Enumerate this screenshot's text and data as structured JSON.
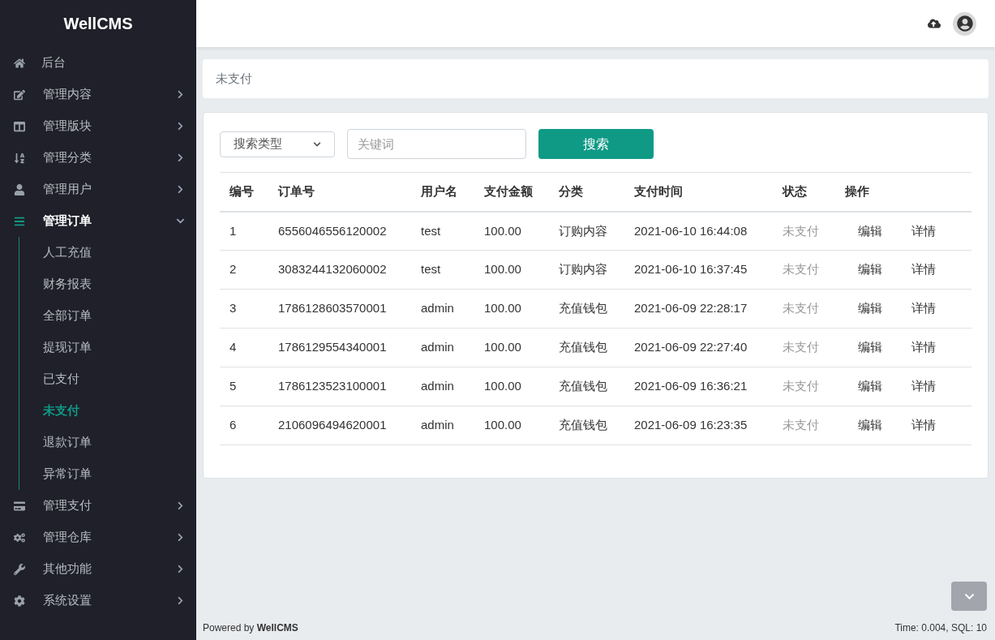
{
  "sidebar": {
    "brand": "WellCMS",
    "items": [
      {
        "label": "后台",
        "kind": "link"
      },
      {
        "label": "管理内容",
        "kind": "group",
        "expanded": false
      },
      {
        "label": "管理版块",
        "kind": "group",
        "expanded": false
      },
      {
        "label": "管理分类",
        "kind": "group",
        "expanded": false
      },
      {
        "label": "管理用户",
        "kind": "group",
        "expanded": false
      },
      {
        "label": "管理订单",
        "kind": "group",
        "expanded": true,
        "children": [
          {
            "label": "人工充值",
            "selected": false
          },
          {
            "label": "财务报表",
            "selected": false
          },
          {
            "label": "全部订单",
            "selected": false
          },
          {
            "label": "提现订单",
            "selected": false
          },
          {
            "label": "已支付",
            "selected": false
          },
          {
            "label": "未支付",
            "selected": true
          },
          {
            "label": "退款订单",
            "selected": false
          },
          {
            "label": "异常订单",
            "selected": false
          }
        ]
      },
      {
        "label": "管理支付",
        "kind": "group",
        "expanded": false
      },
      {
        "label": "管理仓库",
        "kind": "group",
        "expanded": false
      },
      {
        "label": "其他功能",
        "kind": "group",
        "expanded": false
      },
      {
        "label": "系统设置",
        "kind": "group",
        "expanded": false
      }
    ]
  },
  "breadcrumb": "未支付",
  "search": {
    "type_select": "搜索类型",
    "placeholder": "关键词",
    "button": "搜索"
  },
  "table": {
    "columns": [
      "编号",
      "订单号",
      "用户名",
      "支付金额",
      "分类",
      "支付时间",
      "状态",
      "操作"
    ],
    "rows": [
      {
        "id": "1",
        "order_no": "6556046556120002",
        "user": "test",
        "amount": "100.00",
        "category": "订购内容",
        "time": "2021-06-10 16:44:08",
        "status": "未支付",
        "actions": [
          "编辑",
          "详情"
        ]
      },
      {
        "id": "2",
        "order_no": "3083244132060002",
        "user": "test",
        "amount": "100.00",
        "category": "订购内容",
        "time": "2021-06-10 16:37:45",
        "status": "未支付",
        "actions": [
          "编辑",
          "详情"
        ]
      },
      {
        "id": "3",
        "order_no": "1786128603570001",
        "user": "admin",
        "amount": "100.00",
        "category": "充值钱包",
        "time": "2021-06-09 22:28:17",
        "status": "未支付",
        "actions": [
          "编辑",
          "详情"
        ]
      },
      {
        "id": "4",
        "order_no": "1786129554340001",
        "user": "admin",
        "amount": "100.00",
        "category": "充值钱包",
        "time": "2021-06-09 22:27:40",
        "status": "未支付",
        "actions": [
          "编辑",
          "详情"
        ]
      },
      {
        "id": "5",
        "order_no": "1786123523100001",
        "user": "admin",
        "amount": "100.00",
        "category": "充值钱包",
        "time": "2021-06-09 16:36:21",
        "status": "未支付",
        "actions": [
          "编辑",
          "详情"
        ]
      },
      {
        "id": "6",
        "order_no": "2106096494620001",
        "user": "admin",
        "amount": "100.00",
        "category": "充值钱包",
        "time": "2021-06-09 16:23:35",
        "status": "未支付",
        "actions": [
          "编辑",
          "详情"
        ]
      }
    ]
  },
  "footer": {
    "powered": "Powered by **WellCMS**",
    "stats": "Time: 0.004, SQL: 10"
  }
}
